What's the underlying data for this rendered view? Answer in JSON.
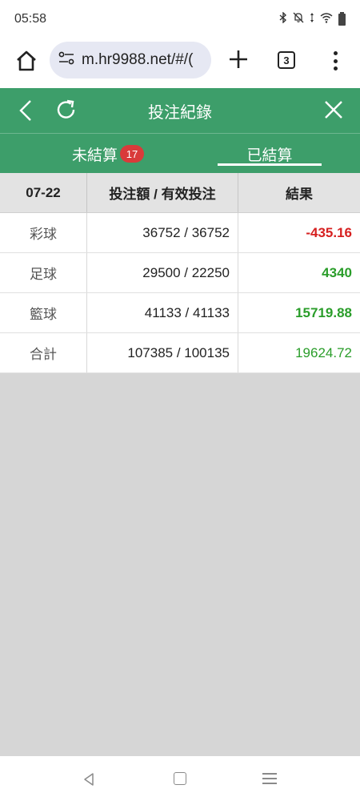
{
  "status": {
    "time": "05:58",
    "icons": [
      "bluetooth-icon",
      "mute-icon",
      "data-arrows-icon",
      "wifi-icon",
      "battery-icon"
    ]
  },
  "browser": {
    "url": "m.hr9988.net/#/(",
    "tab_count": "3",
    "icons": [
      "home-icon",
      "site-settings-icon",
      "new-tab-icon",
      "more-icon"
    ]
  },
  "header": {
    "title": "投注紀錄",
    "icons": [
      "back-icon",
      "refresh-icon",
      "close-icon"
    ]
  },
  "tabs": {
    "unsettled_label": "未結算",
    "unsettled_count": "17",
    "settled_label": "已結算",
    "active": "settled"
  },
  "table": {
    "headers": {
      "date": "07-22",
      "stake": "投注額 / 有效投注",
      "result": "結果"
    },
    "rows": [
      {
        "category": "彩球",
        "stake": "36752 / 36752",
        "result": "-435.16"
      },
      {
        "category": "足球",
        "stake": "29500 / 22250",
        "result": "4340"
      },
      {
        "category": "籃球",
        "stake": "41133 / 41133",
        "result": "15719.88"
      }
    ],
    "total": {
      "category": "合計",
      "stake": "107385 / 100135",
      "result": "19624.72"
    }
  },
  "colors": {
    "primary": "#3d9e6a",
    "badge": "#d93a3a",
    "negative": "#d62020",
    "positive": "#2a9d2a",
    "background": "#d6d6d6"
  }
}
